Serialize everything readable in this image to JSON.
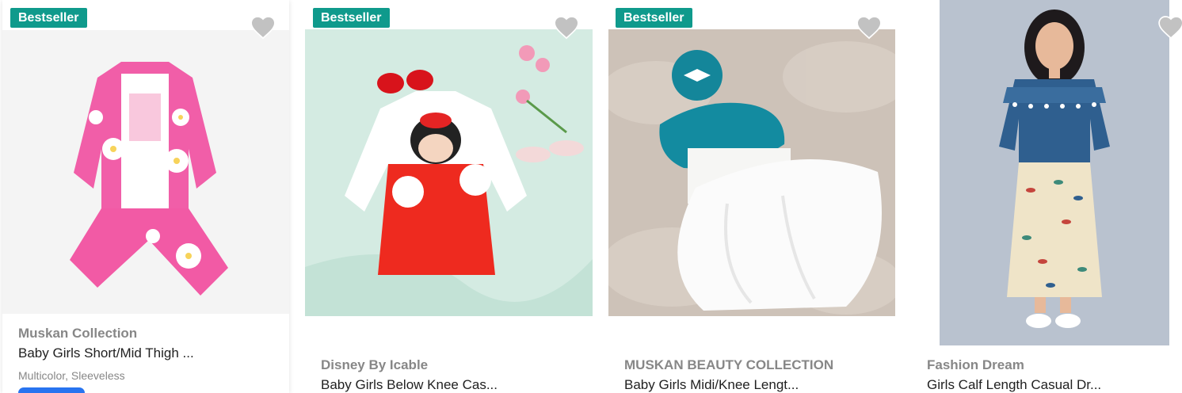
{
  "products": [
    {
      "badge": "Bestseller",
      "brand": "Muskan Collection",
      "title": "Baby Girls Short/Mid Thigh ...",
      "meta": "Multicolor, Sleeveless",
      "image_icon": "pink-jacket-set-image"
    },
    {
      "badge": "Bestseller",
      "brand": "Disney By Icable",
      "title": "Baby Girls Below Knee Cas...",
      "image_icon": "minnie-dress-image"
    },
    {
      "badge": "Bestseller",
      "brand": "MUSKAN BEAUTY COLLECTION",
      "title": "Baby Girls Midi/Knee Lengt...",
      "image_icon": "tutu-dress-image"
    },
    {
      "brand": "Fashion Dream",
      "title": "Girls Calf Length Casual Dr...",
      "image_icon": "girl-model-dress-image"
    }
  ],
  "colors": {
    "badge_bg": "#0f9a8c",
    "heart": "#c2c2c2",
    "brand_text": "#878787",
    "title_text": "#212121"
  }
}
